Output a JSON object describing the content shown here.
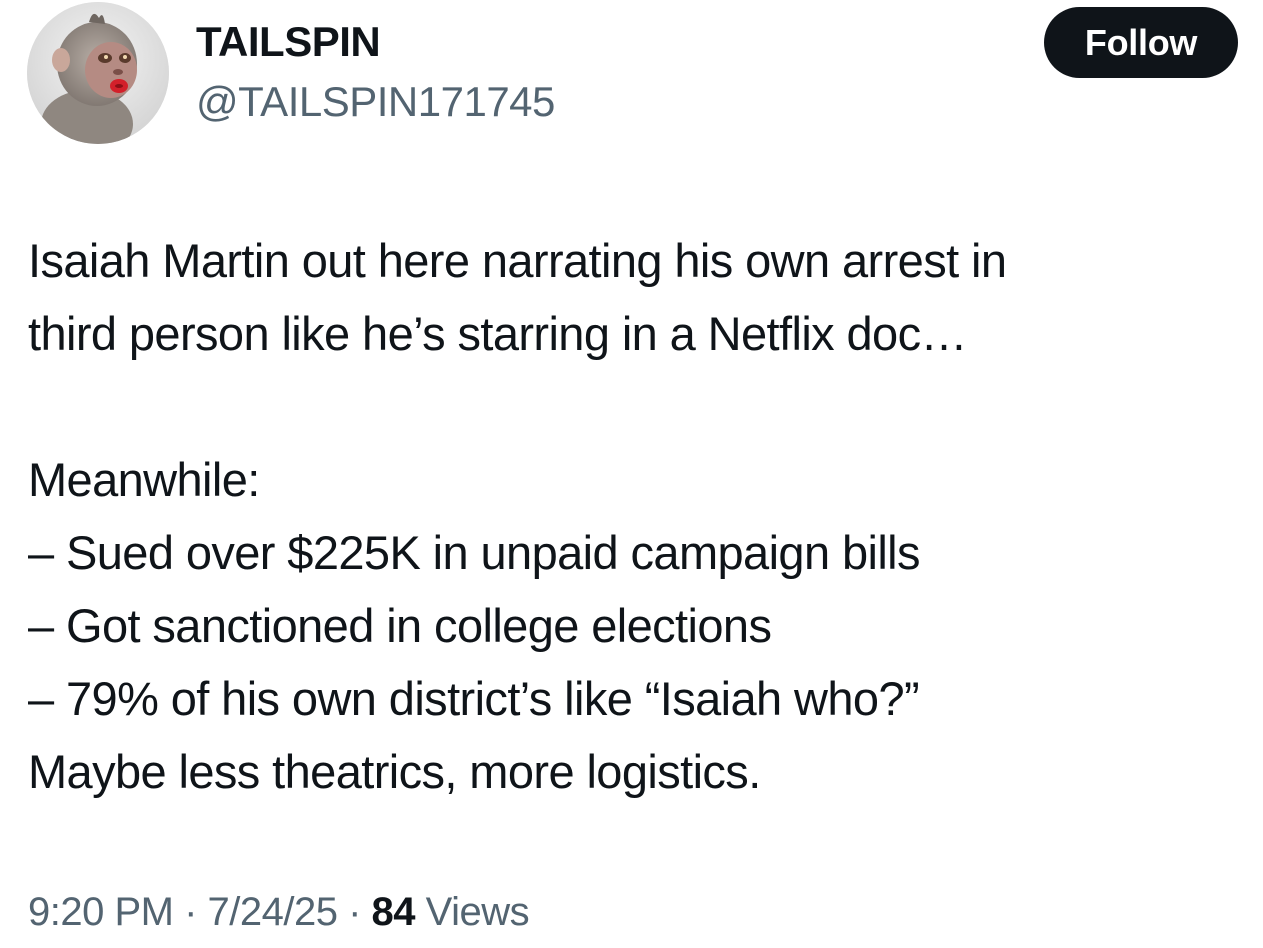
{
  "author": {
    "display_name": "TAILSPIN",
    "handle": "@TAILSPIN171745",
    "avatar_icon": "monkey-avatar-icon"
  },
  "follow_button": {
    "label": "Follow"
  },
  "tweet": {
    "lines": [
      "Isaiah Martin out here narrating his own arrest in",
      "third person like he’s starring in a Netflix doc…",
      "",
      "Meanwhile:",
      "– Sued over $225K in unpaid campaign bills",
      "– Got sanctioned in college elections",
      "– 79% of his own district’s like “Isaiah who?”",
      "Maybe less theatrics, more logistics."
    ]
  },
  "meta": {
    "time": "9:20 PM",
    "separator": " · ",
    "date": "7/24/25",
    "views_count": "84",
    "views_label": " Views"
  },
  "colors": {
    "text_primary": "#0f1419",
    "text_secondary": "#536471",
    "button_bg": "#0f1419",
    "button_text": "#ffffff"
  }
}
